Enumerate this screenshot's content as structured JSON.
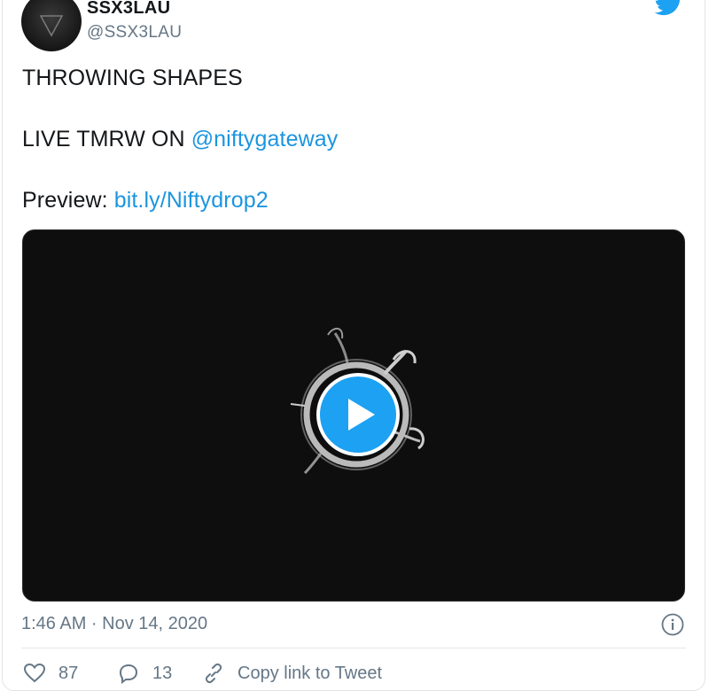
{
  "user": {
    "display_name": "SSX3LAU",
    "handle": "@SSX3LAU"
  },
  "tweet": {
    "line1": "THROWING SHAPES",
    "line2_prefix": "LIVE TMRW ON ",
    "line2_mention": "@niftygateway",
    "line3_prefix": "Preview: ",
    "line3_link": "bit.ly/Niftydrop2"
  },
  "timestamp": "1:46 AM · Nov 14, 2020",
  "actions": {
    "likes": "87",
    "replies": "13",
    "copy_link": "Copy link to Tweet"
  },
  "colors": {
    "link": "#1b95e0",
    "play_button": "#1da1f2",
    "muted_text": "#657786"
  },
  "icons": [
    "twitter-bird-icon",
    "play-icon",
    "info-icon",
    "heart-icon",
    "reply-icon",
    "link-icon"
  ]
}
